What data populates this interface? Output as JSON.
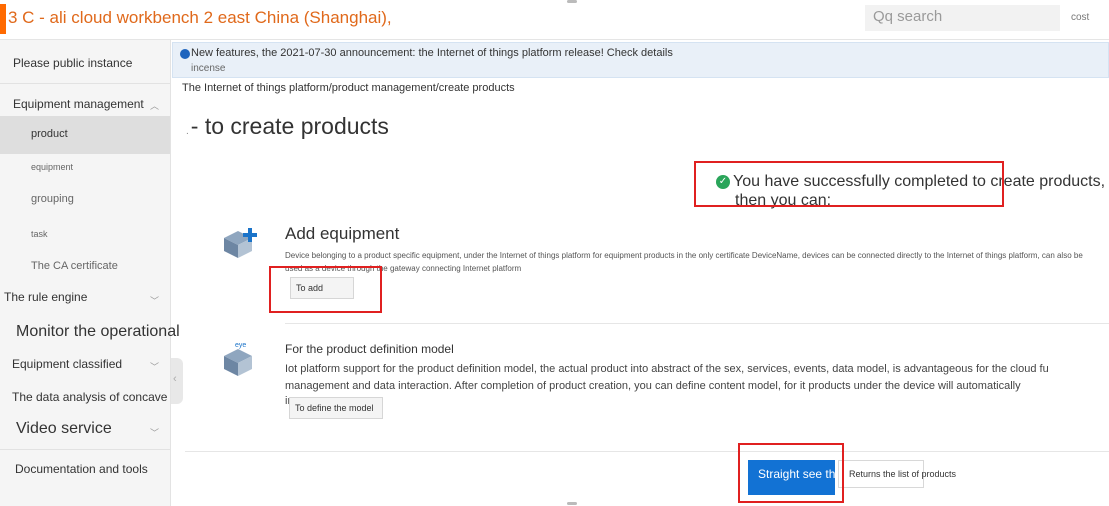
{
  "header": {
    "title": "3 C - ali cloud workbench 2 east China (Shanghai),",
    "search_placeholder": "Qq search",
    "cost_label": "cost"
  },
  "sidebar": {
    "items": [
      {
        "label": "Please public instance"
      },
      {
        "label": "Equipment management"
      },
      {
        "label": "product"
      },
      {
        "label": "equipment"
      },
      {
        "label": "grouping"
      },
      {
        "label": "task"
      },
      {
        "label": "The CA certificate"
      },
      {
        "label": "The rule engine"
      },
      {
        "label": "Monitor the operational"
      },
      {
        "label": "Equipment classified"
      },
      {
        "label": "The data analysis of concave"
      },
      {
        "label": "Video service"
      },
      {
        "label": "Documentation and tools"
      }
    ]
  },
  "notice": {
    "text": "New features, the 2021-07-30 announcement: the Internet of things platform release! Check details",
    "sub": "incense"
  },
  "breadcrumb": "The Internet of things platform/product management/create products",
  "page": {
    "title_prefix": ".",
    "title": "- to create products"
  },
  "success": {
    "line1": "You have successfully completed to create products,",
    "line2": "then you can:"
  },
  "add_equipment": {
    "title": "Add equipment",
    "description": "Device belonging to a product specific equipment, under the Internet of things platform for equipment products in the only certificate DeviceName, devices can be connected directly to the Internet of things platform, can also be used as a device through the gateway connecting Internet platform",
    "button": "To add"
  },
  "define_model": {
    "title": "For the product definition model",
    "icon_label": "eye",
    "line1": "Iot platform support for the product definition model, the actual product into abstract of the sex, services, events, data model, is advantageous for the cloud fu",
    "line2": "management and data interaction. After completion of product creation, you can define content model, for it products under the device will automatically",
    "line3": "in",
    "button": "To define the model"
  },
  "footer_actions": {
    "primary": "Straight see th",
    "secondary": "Returns the list of products"
  },
  "colors": {
    "brand_orange": "#ff6a00",
    "primary_blue": "#1272d4",
    "success_green": "#2aa55a",
    "highlight_red": "#e02020"
  }
}
